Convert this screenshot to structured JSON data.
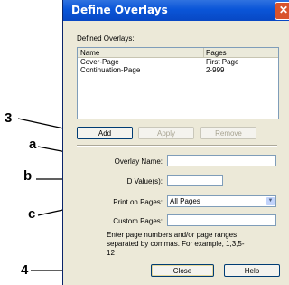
{
  "dialog": {
    "title": "Define Overlays",
    "defined_overlays_label": "Defined Overlays:",
    "list": {
      "columns": [
        "Name",
        "Pages"
      ],
      "rows": [
        {
          "name": "Cover-Page",
          "pages": "First Page"
        },
        {
          "name": "Continuation-Page",
          "pages": "2-999"
        }
      ]
    },
    "buttons": {
      "add": "Add",
      "apply": "Apply",
      "remove": "Remove",
      "close": "Close",
      "help": "Help"
    },
    "fields": {
      "overlay_name_label": "Overlay Name:",
      "overlay_name_value": "",
      "id_values_label": "ID Value(s):",
      "id_values_value": "",
      "print_on_pages_label": "Print on Pages:",
      "print_on_pages_value": "All Pages",
      "custom_pages_label": "Custom Pages:",
      "custom_pages_value": ""
    },
    "help_text": "Enter page numbers and/or page ranges separated by commas. For example, 1,3,5-12"
  },
  "callouts": {
    "three": "3",
    "a": "a",
    "b": "b",
    "c": "c",
    "four": "4"
  }
}
